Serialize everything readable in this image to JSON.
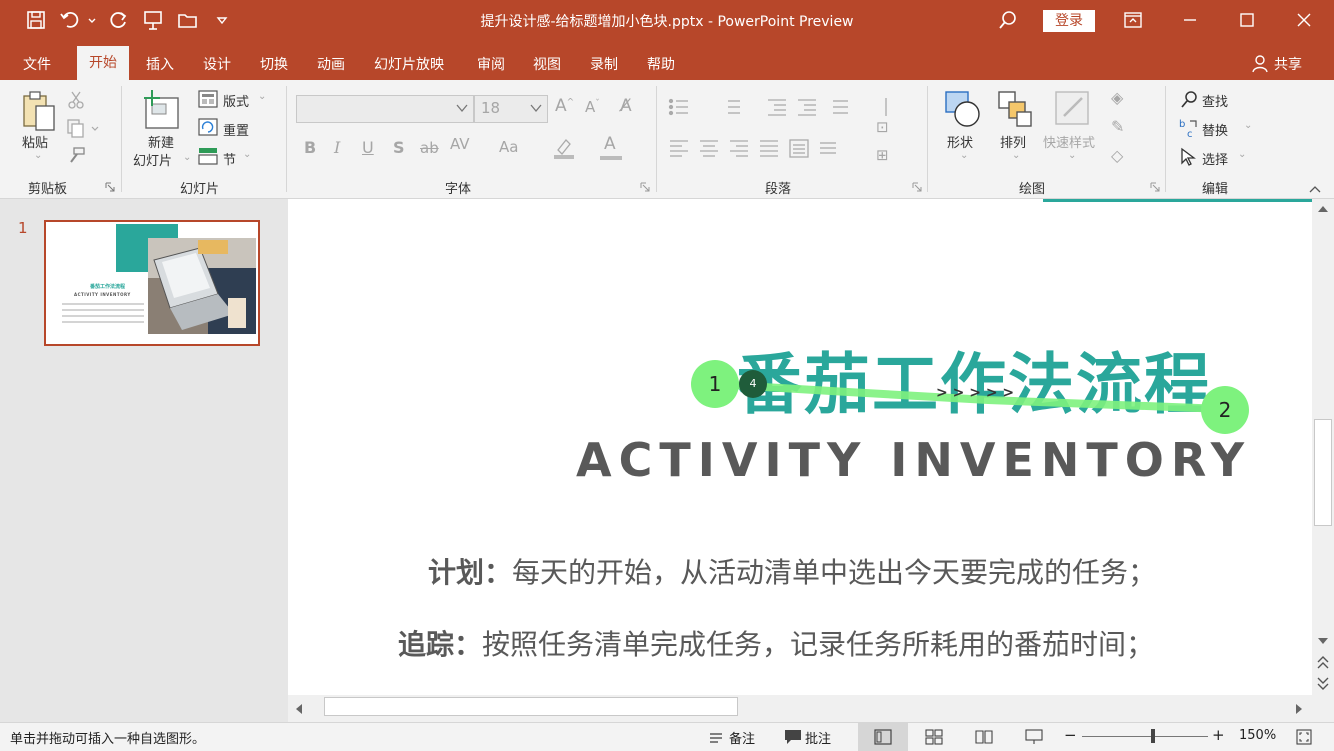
{
  "window": {
    "title": "提升设计感-给标题增加小色块.pptx  -  PowerPoint Preview",
    "login_label": "登录",
    "share_label": "共享"
  },
  "tabs": [
    {
      "label": "文件"
    },
    {
      "label": "开始"
    },
    {
      "label": "插入"
    },
    {
      "label": "设计"
    },
    {
      "label": "切换"
    },
    {
      "label": "动画"
    },
    {
      "label": "幻灯片放映"
    },
    {
      "label": "审阅"
    },
    {
      "label": "视图"
    },
    {
      "label": "录制"
    },
    {
      "label": "帮助"
    }
  ],
  "ribbon": {
    "clipboard": {
      "paste": "粘贴",
      "group": "剪贴板"
    },
    "slides": {
      "new_slide_line1": "新建",
      "new_slide_line2": "幻灯片",
      "layout": "版式",
      "reset": "重置",
      "section": "节",
      "group": "幻灯片"
    },
    "font": {
      "font_name": "",
      "font_size": "18",
      "group": "字体"
    },
    "paragraph": {
      "group": "段落"
    },
    "drawing": {
      "shapes": "形状",
      "arrange": "排列",
      "quick_styles": "快速样式",
      "group": "绘图"
    },
    "editing": {
      "find": "查找",
      "replace": "替换",
      "select": "选择",
      "group": "编辑"
    }
  },
  "thumbnail": {
    "number": "1",
    "title": "番茄工作法流程",
    "subtitle": "ACTIVITY INVENTORY"
  },
  "slide": {
    "title": "番茄工作法流程",
    "subtitle": "ACTIVITY INVENTORY",
    "lines": [
      {
        "label": "计划：",
        "text": "每天的开始，从活动清单中选出今天要完成的任务；"
      },
      {
        "label": "追踪：",
        "text": "按照任务清单完成任务，记录任务所耗用的番茄时间；"
      }
    ],
    "accent_color": "#2aa79b",
    "annotation": {
      "start": "1",
      "end": "2",
      "step": "4",
      "arrows": "> > > > >",
      "color": "#7ef27e"
    }
  },
  "status": {
    "message": "单击并拖动可插入一种自选图形。",
    "notes": "备注",
    "comments": "批注",
    "zoom": "150%"
  }
}
